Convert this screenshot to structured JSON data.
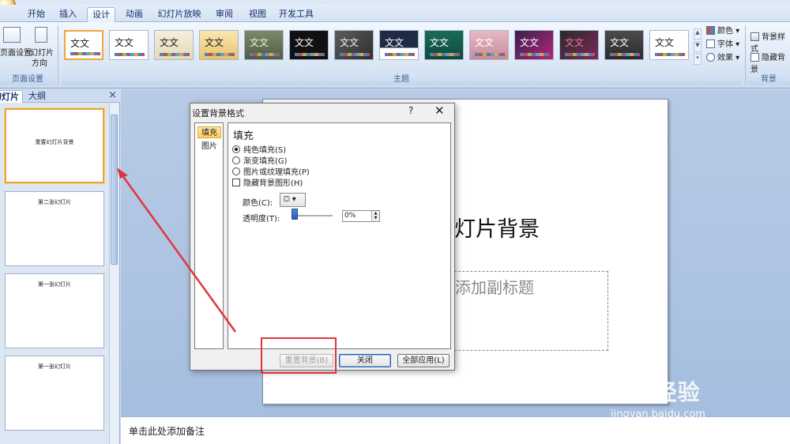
{
  "ribbon_tabs": [
    "开始",
    "插入",
    "设计",
    "动画",
    "幻灯片放映",
    "审阅",
    "视图",
    "开发工具"
  ],
  "active_tab": "设计",
  "page_setup": {
    "page_setup_label": "页面设置",
    "orientation_label_1": "幻灯片",
    "orientation_label_2": "方向",
    "group_label": "页面设置"
  },
  "themes": {
    "group_label": "主题",
    "sample_text": "文文",
    "sample_text_alt": "文文",
    "count": 14
  },
  "theme_options": {
    "colors": "颜色",
    "fonts": "字体",
    "effects": "效果"
  },
  "background": {
    "styles": "背景样式",
    "hide_graphics": "隐藏背景",
    "group_label": "背景"
  },
  "panel": {
    "tab_slides": "幻灯片",
    "tab_outline": "大纲",
    "close": "×",
    "thumbnails": [
      "重置幻灯片背景",
      "第二张幻灯片",
      "第一张幻灯片",
      "第一张幻灯片"
    ]
  },
  "slide": {
    "title": "灯片背景",
    "subtitle_placeholder": "添加副标题"
  },
  "notes_placeholder": "单击此处添加备注",
  "dialog": {
    "title": "设置背景格式",
    "help": "?",
    "close": "✕",
    "nav_fill": "填充",
    "nav_picture": "图片",
    "heading": "填充",
    "options": {
      "solid": "纯色填充(S)",
      "gradient": "渐变填充(G)",
      "picture_texture": "图片或纹理填充(P)"
    },
    "hide_bg_graphics": "隐藏背景图形(H)",
    "color_label": "颜色(C):",
    "transparency_label": "透明度(T):",
    "transparency_value": "0%",
    "transparency_level": 0,
    "btn_reset": "重置背景(B)",
    "btn_close": "关闭",
    "btn_apply_all": "全部应用(L)"
  },
  "watermark": {
    "brand": "Bai 经验",
    "url": "jingyan.baidu.com"
  }
}
